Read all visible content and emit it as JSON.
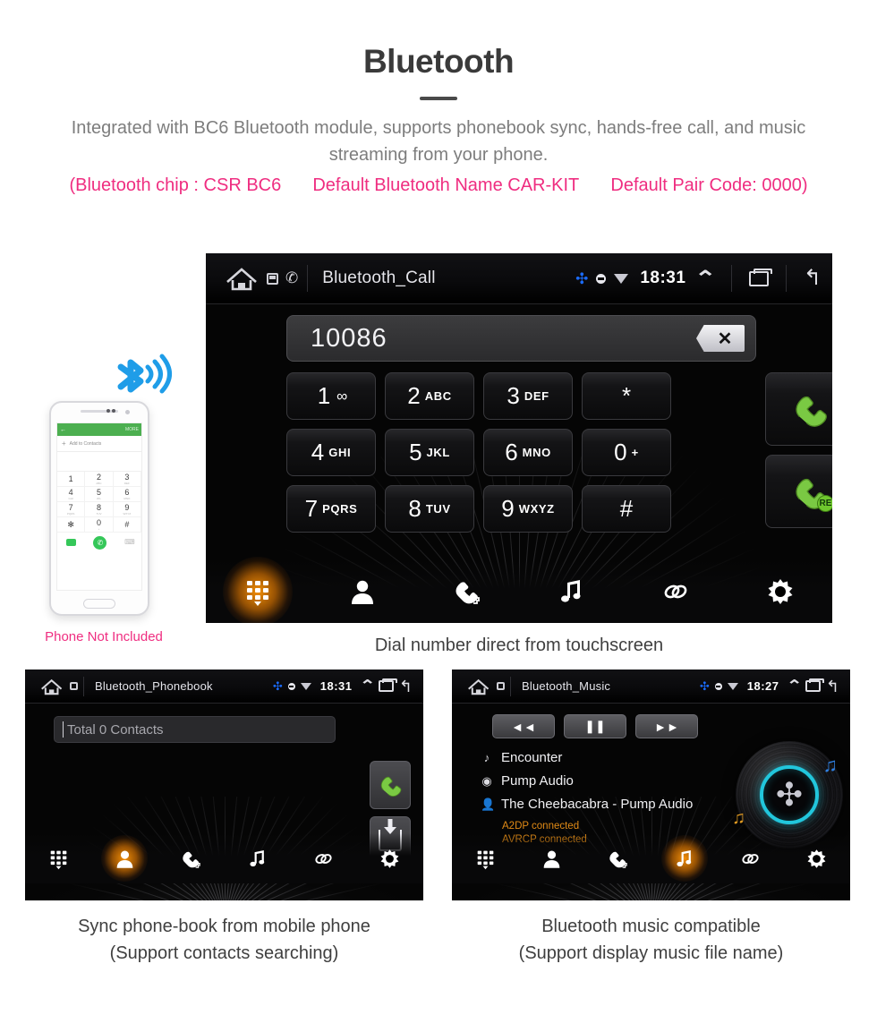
{
  "header": {
    "title": "Bluetooth",
    "subtitle": "Integrated with BC6 Bluetooth module, supports phonebook sync, hands-free call, and music streaming from your phone.",
    "spec_chip": "(Bluetooth chip : CSR BC6",
    "spec_name": "Default Bluetooth Name CAR-KIT",
    "spec_pair": "Default Pair Code: 0000)"
  },
  "phone_mock": {
    "note": "Phone Not Included",
    "back_arrow": "←",
    "more_label": "MORE",
    "add_plus": "+",
    "add_label": "Add to Contacts",
    "keys": [
      {
        "digit": "1",
        "letters": ""
      },
      {
        "digit": "2",
        "letters": "ABC"
      },
      {
        "digit": "3",
        "letters": "DEF"
      },
      {
        "digit": "4",
        "letters": "GHI"
      },
      {
        "digit": "5",
        "letters": "JKL"
      },
      {
        "digit": "6",
        "letters": "MNO"
      },
      {
        "digit": "7",
        "letters": "PQRS"
      },
      {
        "digit": "8",
        "letters": "TUV"
      },
      {
        "digit": "9",
        "letters": "WXYZ"
      },
      {
        "digit": "✻",
        "letters": ""
      },
      {
        "digit": "0",
        "letters": "+"
      },
      {
        "digit": "#",
        "letters": ""
      }
    ],
    "call_glyph": "✆"
  },
  "call_screen": {
    "statusbar": {
      "title": "Bluetooth_Call",
      "time": "18:31",
      "bt_icon": "bluetooth-icon",
      "signal_icon": "signal-icon",
      "wifi_icon": "wifi-icon",
      "chevron": "⌃",
      "recent_icon": "recent-apps-icon",
      "back_icon": "back-icon",
      "home_icon": "home-icon"
    },
    "number": "10086",
    "backspace_glyph": "✕",
    "keys": [
      {
        "digit": "1",
        "letters": "",
        "voicemail": true
      },
      {
        "digit": "2",
        "letters": "ABC"
      },
      {
        "digit": "3",
        "letters": "DEF"
      },
      {
        "digit": "*",
        "letters": ""
      },
      {
        "digit": "4",
        "letters": "GHI"
      },
      {
        "digit": "5",
        "letters": "JKL"
      },
      {
        "digit": "6",
        "letters": "MNO"
      },
      {
        "digit": "0",
        "letters": "+"
      },
      {
        "digit": "7",
        "letters": "PQRS"
      },
      {
        "digit": "8",
        "letters": "TUV"
      },
      {
        "digit": "9",
        "letters": "WXYZ"
      },
      {
        "digit": "#",
        "letters": ""
      }
    ],
    "dial_button": "call-button",
    "redial_button": "redial-button",
    "redial_badge": "RE",
    "caption": "Dial number direct from touchscreen",
    "nav": [
      {
        "name": "dialpad",
        "active": true
      },
      {
        "name": "contacts",
        "active": false
      },
      {
        "name": "call-history",
        "active": false
      },
      {
        "name": "music",
        "active": false
      },
      {
        "name": "link",
        "active": false
      },
      {
        "name": "settings",
        "active": false
      }
    ]
  },
  "phonebook_screen": {
    "statusbar": {
      "title": "Bluetooth_Phonebook",
      "time": "18:31"
    },
    "search_value": "Total 0 Contacts",
    "call_button": "call-button",
    "download_button": "download-contacts-button",
    "caption_line1": "Sync phone-book from mobile phone",
    "caption_line2": "(Support contacts searching)",
    "nav": [
      {
        "name": "dialpad",
        "active": false
      },
      {
        "name": "contacts",
        "active": true
      },
      {
        "name": "call-history",
        "active": false
      },
      {
        "name": "music",
        "active": false
      },
      {
        "name": "link",
        "active": false
      },
      {
        "name": "settings",
        "active": false
      }
    ]
  },
  "music_screen": {
    "statusbar": {
      "title": "Bluetooth_Music",
      "time": "18:27"
    },
    "controls": [
      {
        "name": "previous-track-button",
        "glyph": "◄◄"
      },
      {
        "name": "pause-button",
        "glyph": "❚❚"
      },
      {
        "name": "next-track-button",
        "glyph": "►►"
      }
    ],
    "track_title": "Encounter",
    "album": "Pump Audio",
    "artist": "The Cheebacabra - Pump Audio",
    "status_a2dp": "A2DP connected",
    "status_avrcp": "AVRCP connected",
    "caption_line1": "Bluetooth music compatible",
    "caption_line2": "(Support display music file name)",
    "nav": [
      {
        "name": "dialpad",
        "active": false
      },
      {
        "name": "contacts",
        "active": false
      },
      {
        "name": "call-history",
        "active": false
      },
      {
        "name": "music",
        "active": true
      },
      {
        "name": "link",
        "active": false
      },
      {
        "name": "settings",
        "active": false
      }
    ]
  },
  "colors": {
    "accent_pink": "#ef2d80",
    "nav_active": "#ff9608",
    "bluetooth_blue": "#1b6cff",
    "status_orange": "#e08a16",
    "handset_green": "#7ac943",
    "ring_cyan": "#21c6dc"
  }
}
